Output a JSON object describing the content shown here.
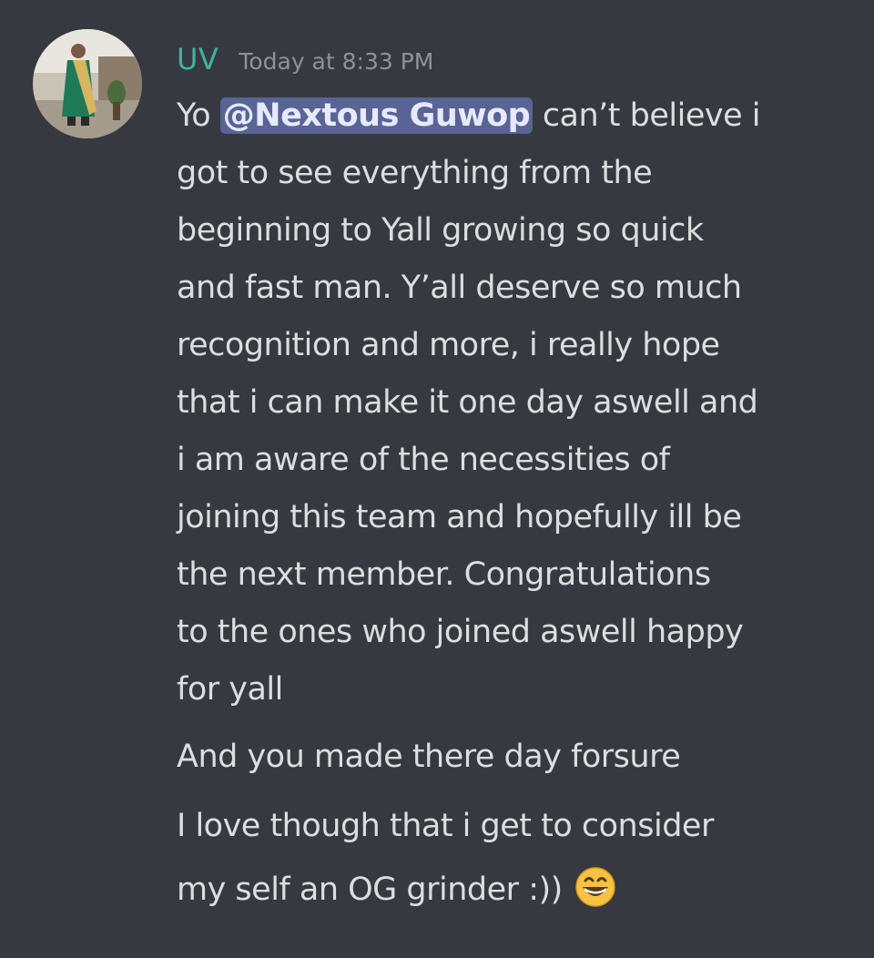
{
  "message": {
    "username": "UV",
    "timestamp": "Today at 8:33 PM",
    "username_color": "#43b0a2",
    "avatar_icon": "user-avatar-photo",
    "first_line": {
      "prefix": "Yo ",
      "mention": "@Nextous Guwop",
      "suffix": " can’t believe i"
    },
    "lines": [
      "got to see everything from the",
      "beginning to Yall growing so quick",
      "and fast man. Y’all deserve so much",
      "recognition and more, i really hope",
      "that i can make it one day aswell and",
      "i am aware of the necessities of",
      "joining this team and hopefully ill be",
      "the next member. Congratulations",
      "to the ones who joined aswell happy",
      "for yall"
    ],
    "followups": [
      "And you made there day forsure",
      "I love though that i get to consider",
      "my self an OG grinder :))"
    ],
    "emoji": "grinning-face-emoji"
  },
  "colors": {
    "background": "#36393f",
    "text": "#dcddde",
    "timestamp": "#8e9297",
    "mention_bg": "#5865a3"
  }
}
